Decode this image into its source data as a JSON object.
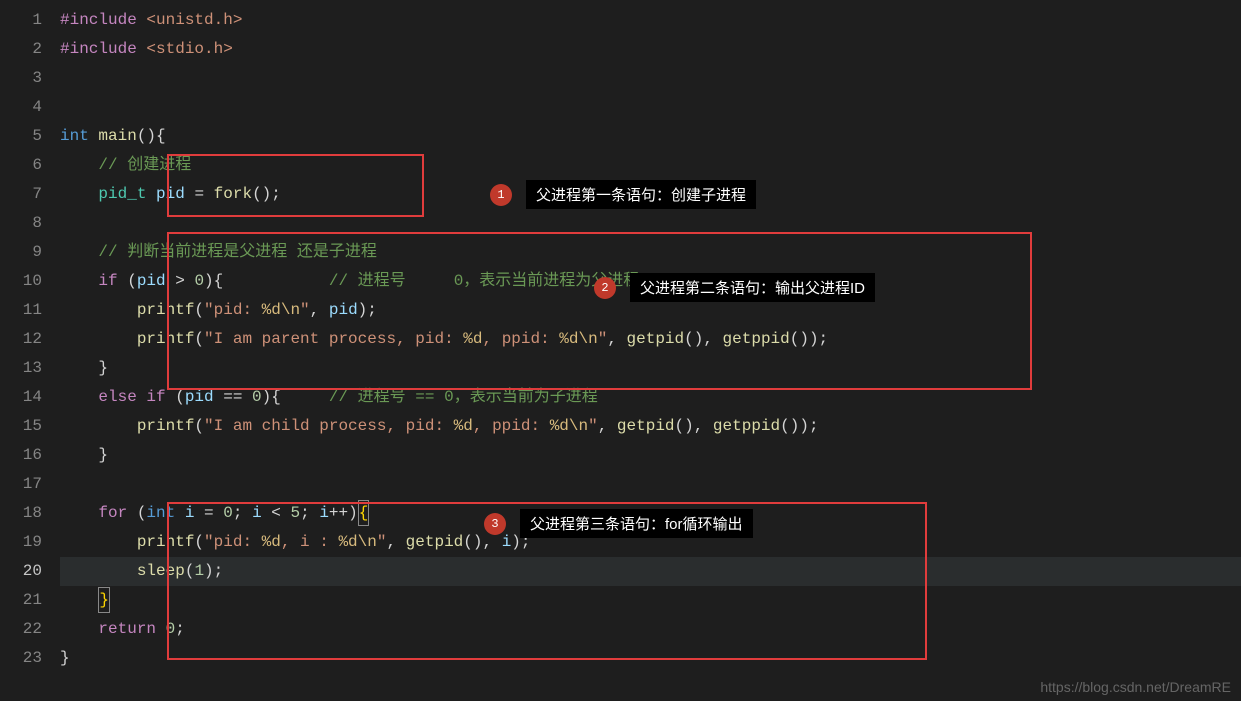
{
  "gutter": {
    "lines": [
      "1",
      "2",
      "3",
      "4",
      "5",
      "6",
      "7",
      "8",
      "9",
      "10",
      "11",
      "12",
      "13",
      "14",
      "15",
      "16",
      "17",
      "18",
      "19",
      "20",
      "21",
      "22",
      "23"
    ],
    "current": 20
  },
  "code": {
    "l1": {
      "pp": "#include",
      "path": "<unistd.h>"
    },
    "l2": {
      "pp": "#include",
      "path": "<stdio.h>"
    },
    "l5": {
      "kw_int": "int",
      "fn_main": "main",
      "paren": "()",
      "brace": "{"
    },
    "l6": {
      "indent": "    ",
      "cm": "// 创建进程"
    },
    "l7": {
      "indent": "    ",
      "ty": "pid_t",
      "id": "pid",
      "eq": " = ",
      "fn": "fork",
      "tail": "();"
    },
    "l9": {
      "indent": "    ",
      "cm": "// 判断当前进程是父进程 还是子进程"
    },
    "l10": {
      "indent": "    ",
      "kw": "if",
      "open": " (",
      "id": "pid",
      "op": " > ",
      "num": "0",
      "close": "){",
      "cm_pad": "           ",
      "cm": "// 进程号     0，表示当前进程为父进程"
    },
    "l11": {
      "indent": "        ",
      "fn": "printf",
      "open": "(",
      "s1": "\"pid: ",
      "esc1": "%d",
      "esc2": "\\n",
      "s2": "\"",
      "mid": ", ",
      "id": "pid",
      "close": ");"
    },
    "l12": {
      "indent": "        ",
      "fn": "printf",
      "open": "(",
      "s1": "\"I am parent process, pid: ",
      "e1": "%d",
      "s2": ", ppid: ",
      "e2": "%d",
      "e3": "\\n",
      "s3": "\"",
      "mid1": ", ",
      "f1": "getpid",
      "p1": "(), ",
      "f2": "getppid",
      "p2": "());"
    },
    "l13": {
      "indent": "    ",
      "brace": "}"
    },
    "l14": {
      "indent": "    ",
      "kw": "else if",
      "open": " (",
      "id": "pid",
      "op": " == ",
      "num": "0",
      "close": "){",
      "cm_pad": "     ",
      "cm": "// 进程号 == 0，表示当前为子进程"
    },
    "l15": {
      "indent": "        ",
      "fn": "printf",
      "open": "(",
      "s1": "\"I am child process, pid: ",
      "e1": "%d",
      "s2": ", ppid: ",
      "e2": "%d",
      "e3": "\\n",
      "s3": "\"",
      "mid1": ", ",
      "f1": "getpid",
      "p1": "(), ",
      "f2": "getppid",
      "p2": "());"
    },
    "l16": {
      "indent": "    ",
      "brace": "}"
    },
    "l18": {
      "indent": "    ",
      "kw": "for",
      "open": " (",
      "kint": "int",
      "sp": " ",
      "i": "i",
      "eq": " = ",
      "z": "0",
      "semi1": "; ",
      "i2": "i",
      "lt": " < ",
      "five": "5",
      "semi2": "; ",
      "i3": "i",
      "pp": "++",
      "close": ")",
      "brace": "{"
    },
    "l19": {
      "indent": "        ",
      "fn": "printf",
      "open": "(",
      "s1": "\"pid: ",
      "e1": "%d",
      "s2": ", i : ",
      "e2": "%d",
      "e3": "\\n",
      "s3": "\"",
      "mid": ", ",
      "f1": "getpid",
      "p1": "(), ",
      "i": "i",
      "close": ");"
    },
    "l20": {
      "indent": "        ",
      "fn": "sleep",
      "open": "(",
      "num": "1",
      "close": ");"
    },
    "l21": {
      "indent": "    ",
      "brace": "}"
    },
    "l22": {
      "indent": "    ",
      "kw": "return",
      "sp": " ",
      "num": "0",
      "semi": ";"
    },
    "l23": {
      "brace": "}"
    }
  },
  "annotations": {
    "a1": {
      "num": "1",
      "text": "父进程第一条语句：创建子进程"
    },
    "a2": {
      "num": "2",
      "text": "父进程第二条语句：输出父进程ID"
    },
    "a3": {
      "num": "3",
      "text": "父进程第三条语句：for循环输出"
    }
  },
  "watermark": "https://blog.csdn.net/DreamRE"
}
